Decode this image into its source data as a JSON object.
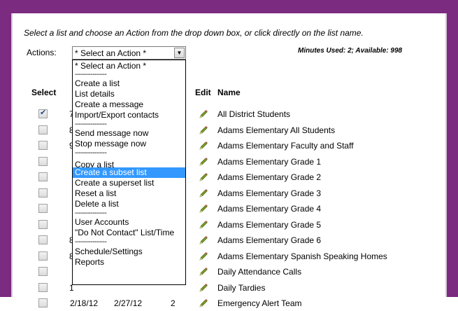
{
  "instructions": "Select a list and choose an Action from the drop down box, or click directly on the list name.",
  "actions_label": "Actions:",
  "minutes": "Minutes Used: 2; Available: 998",
  "select": {
    "value": "* Select an Action *",
    "options": [
      {
        "label": "* Select an Action *",
        "sep": false,
        "selected": false
      },
      {
        "label": "----------------",
        "sep": true,
        "selected": false
      },
      {
        "label": "Create a list",
        "sep": false,
        "selected": false
      },
      {
        "label": "List details",
        "sep": false,
        "selected": false
      },
      {
        "label": "Create a message",
        "sep": false,
        "selected": false
      },
      {
        "label": "Import/Export contacts",
        "sep": false,
        "selected": false
      },
      {
        "label": "----------------",
        "sep": true,
        "selected": false
      },
      {
        "label": "Send message now",
        "sep": false,
        "selected": false
      },
      {
        "label": "Stop message now",
        "sep": false,
        "selected": false
      },
      {
        "label": "----------------",
        "sep": true,
        "selected": false
      },
      {
        "label": "Copy a list",
        "sep": false,
        "selected": false
      },
      {
        "label": "Create a subset list",
        "sep": false,
        "selected": true
      },
      {
        "label": "Create a superset list",
        "sep": false,
        "selected": false
      },
      {
        "label": "Reset a list",
        "sep": false,
        "selected": false
      },
      {
        "label": "Delete a list",
        "sep": false,
        "selected": false
      },
      {
        "label": "----------------",
        "sep": true,
        "selected": false
      },
      {
        "label": "User Accounts",
        "sep": false,
        "selected": false
      },
      {
        "label": "\"Do Not Contact\" List/Time",
        "sep": false,
        "selected": false
      },
      {
        "label": "----------------",
        "sep": true,
        "selected": false
      },
      {
        "label": "Schedule/Settings",
        "sep": false,
        "selected": false
      },
      {
        "label": "Reports",
        "sep": false,
        "selected": false
      }
    ]
  },
  "table": {
    "headers": {
      "select": "Select",
      "edit": "Edit",
      "name": "Name"
    },
    "rows": [
      {
        "checked": true,
        "name": "All District Students",
        "partial": "7"
      },
      {
        "checked": false,
        "name": "Adams Elementary All Students",
        "partial": "8"
      },
      {
        "checked": false,
        "name": "Adams Elementary Faculty and Staff",
        "partial": "9"
      },
      {
        "checked": false,
        "name": "Adams Elementary Grade 1",
        "partial": ""
      },
      {
        "checked": false,
        "name": "Adams Elementary Grade 2",
        "partial": ""
      },
      {
        "checked": false,
        "name": "Adams Elementary Grade 3",
        "partial": ""
      },
      {
        "checked": false,
        "name": "Adams Elementary Grade 4",
        "partial": ""
      },
      {
        "checked": false,
        "name": "Adams Elementary Grade 5",
        "partial": ""
      },
      {
        "checked": false,
        "name": "Adams Elementary Grade 6",
        "partial": "8"
      },
      {
        "checked": false,
        "name": "Adams Elementary Spanish Speaking Homes",
        "partial": "8"
      },
      {
        "checked": false,
        "name": "Daily Attendance Calls",
        "partial": ""
      },
      {
        "checked": false,
        "name": "Daily Tardies",
        "partial": "1"
      },
      {
        "checked": false,
        "name": "Emergency Alert Team",
        "partial": ""
      }
    ],
    "last_row_cells": [
      "2/18/12",
      "2/27/12",
      "2"
    ]
  },
  "colors": {
    "frame": "#7b2b80",
    "selected": "#3399ff",
    "pencil": "#7a9a2a"
  }
}
